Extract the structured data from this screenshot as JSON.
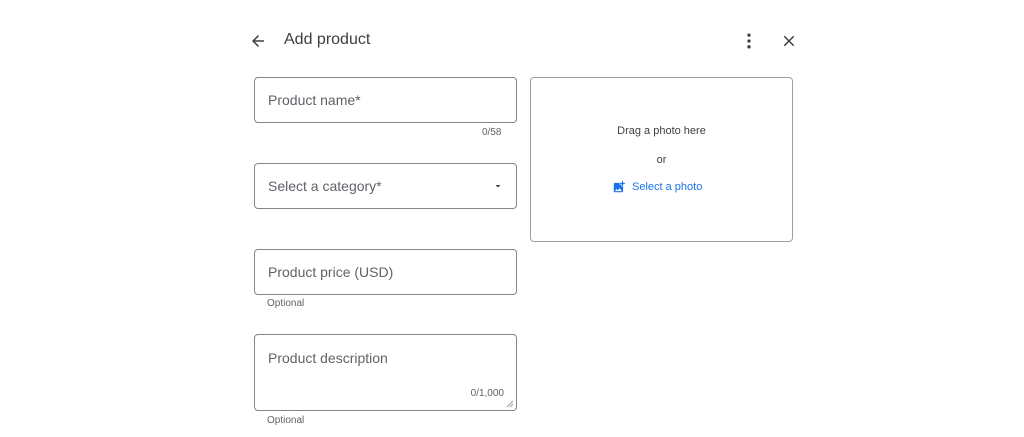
{
  "header": {
    "back_icon": "arrow-back-icon",
    "title": "Add product",
    "more_icon": "more-vert-icon",
    "close_icon": "close-icon"
  },
  "form": {
    "product_name": {
      "placeholder": "Product name*",
      "counter": "0/58"
    },
    "category": {
      "placeholder": "Select a category*",
      "dropdown_icon": "arrow-drop-down-icon"
    },
    "price": {
      "placeholder": "Product price (USD)",
      "helper": "Optional"
    },
    "description": {
      "placeholder": "Product description",
      "counter": "0/1,000",
      "helper": "Optional"
    }
  },
  "photo": {
    "drag_text": "Drag a photo here",
    "or_text": "or",
    "select_label": "Select a photo",
    "select_icon": "add-photo-icon",
    "link_color": "#1a73e8"
  }
}
